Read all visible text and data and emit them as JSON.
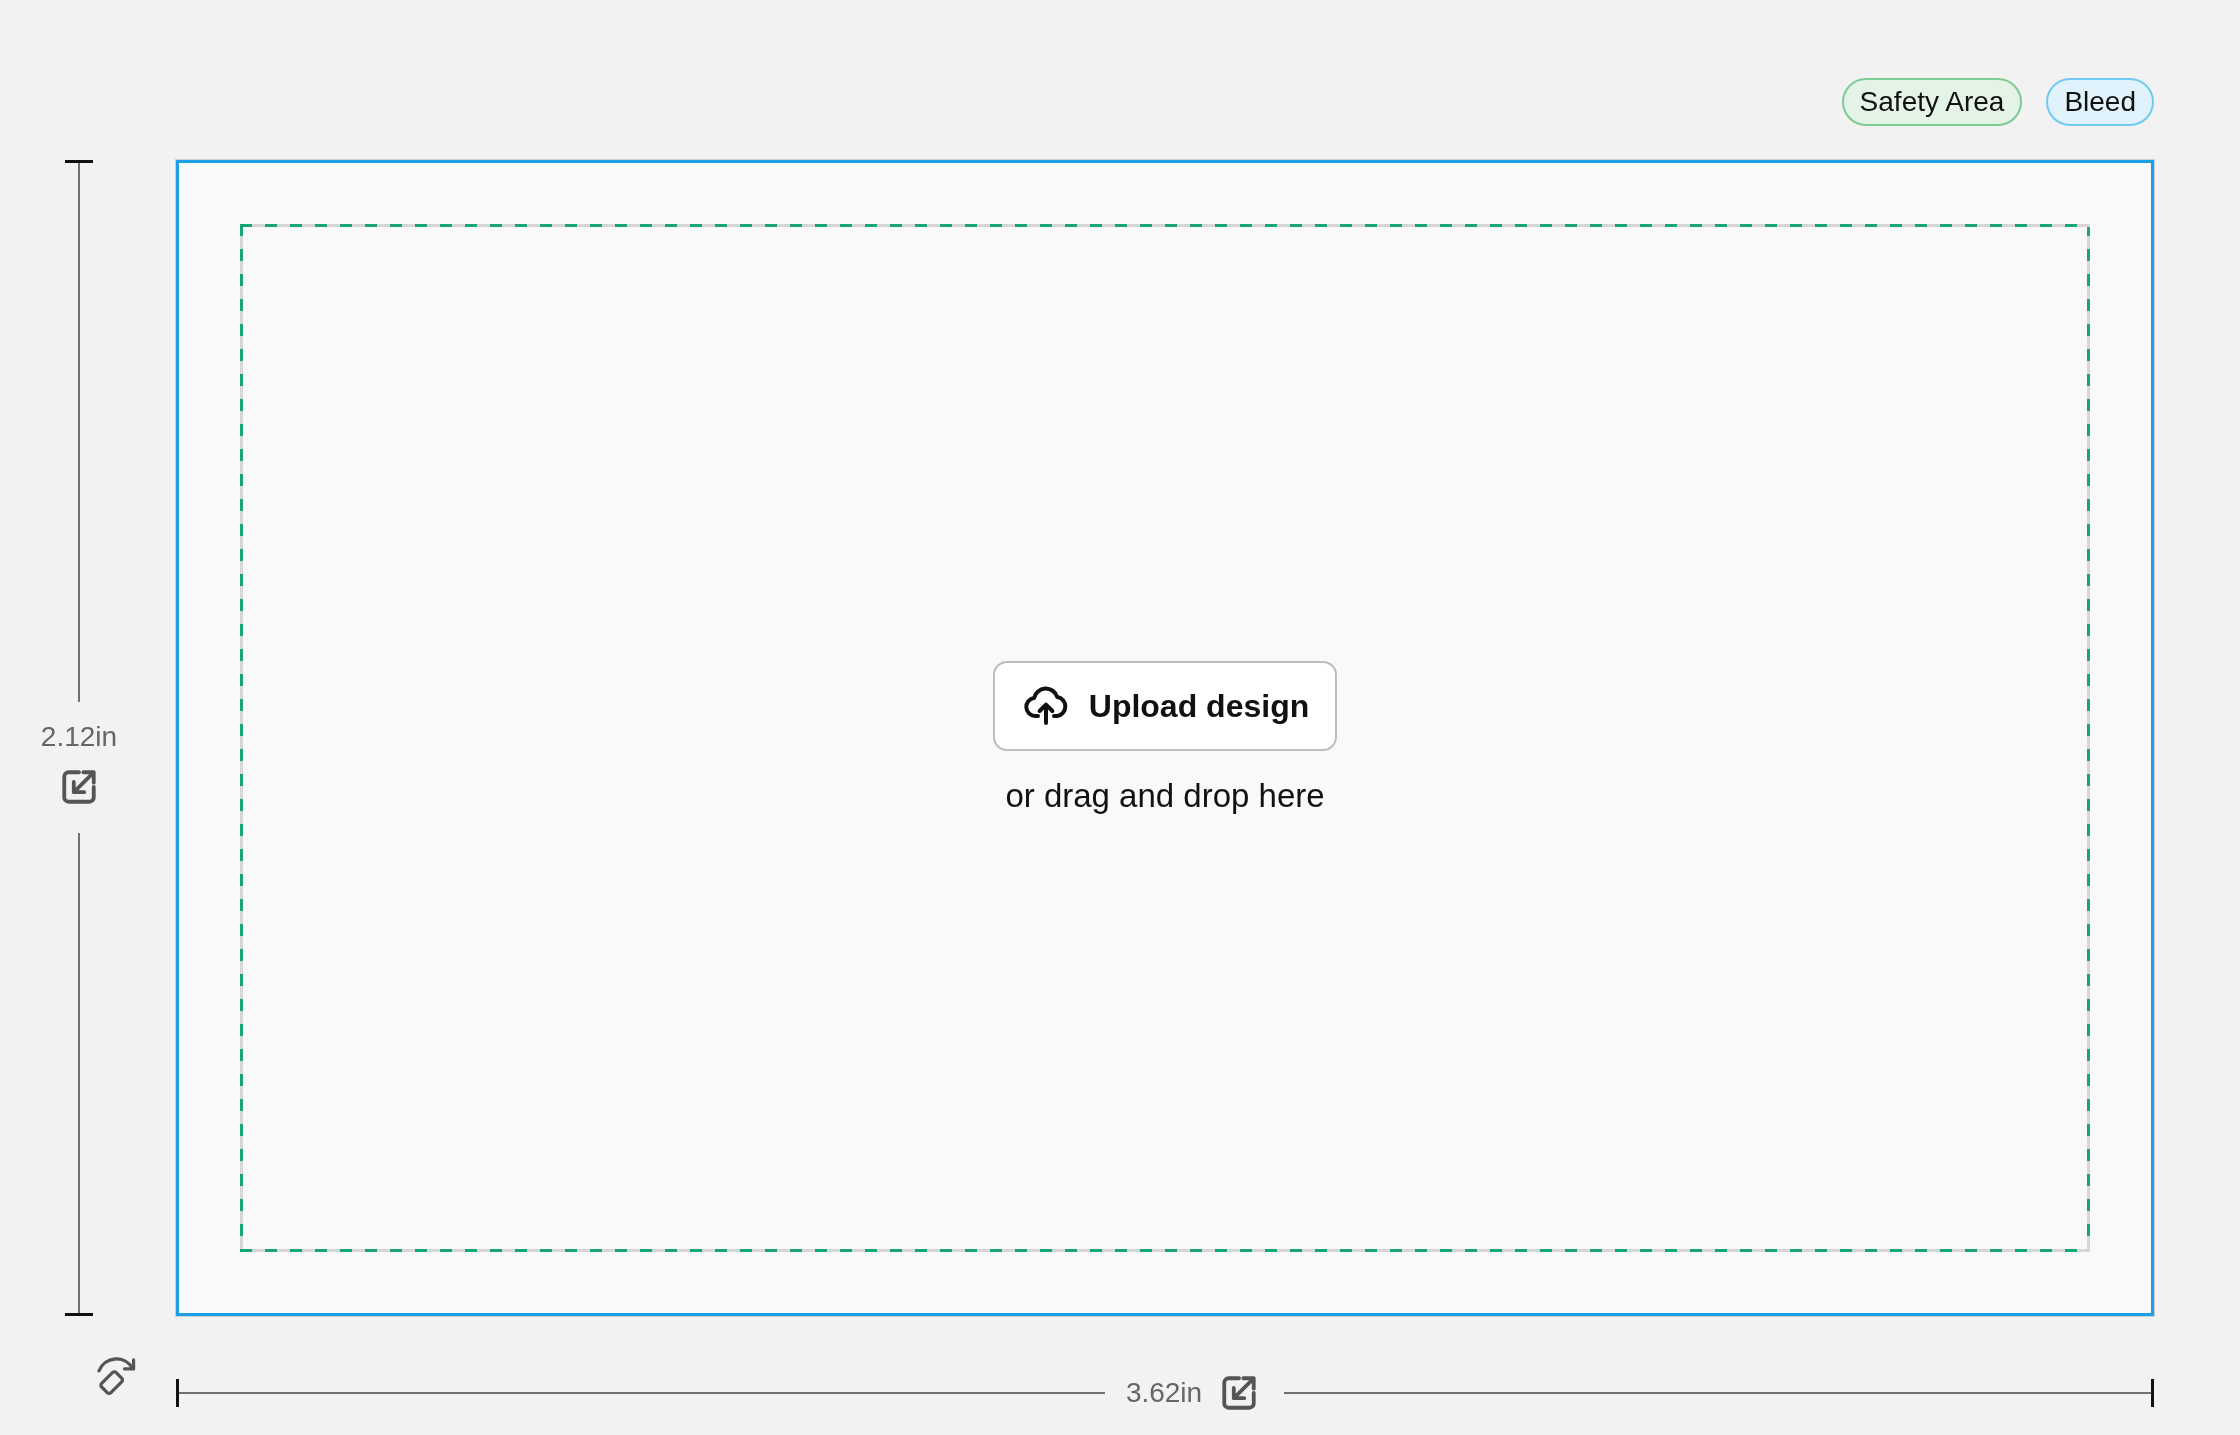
{
  "legend": [
    {
      "label": "Safety Area",
      "color": "#7fcb93"
    },
    {
      "label": "Bleed",
      "color": "#72caf1"
    }
  ],
  "height_ruler": {
    "label": "2.12in"
  },
  "canvas": {
    "upload_button": {
      "label": "Upload design"
    },
    "hint": "or drag and drop here"
  },
  "width_ruler": {
    "label": "3.62in"
  }
}
